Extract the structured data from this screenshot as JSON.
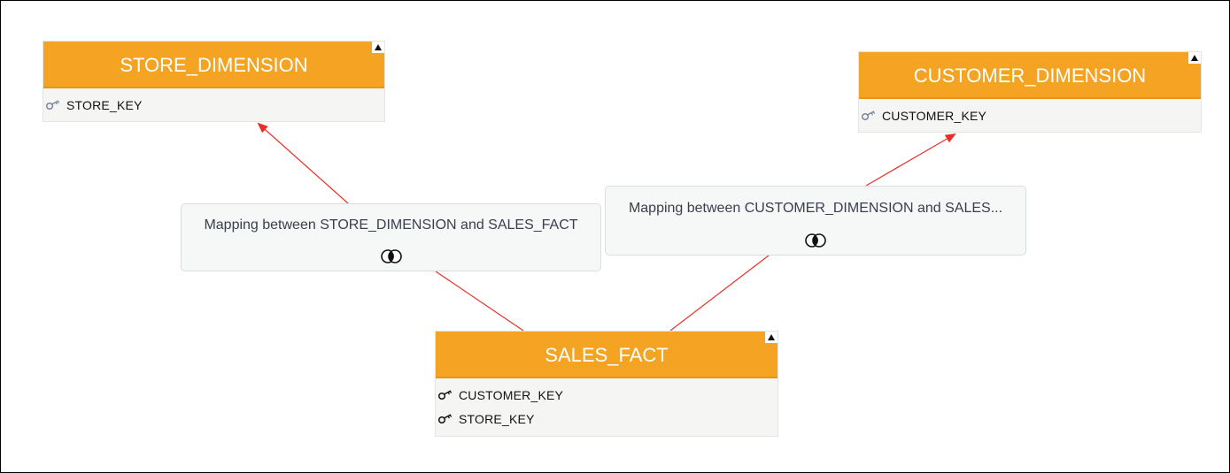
{
  "entities": {
    "store_dimension": {
      "title": "STORE_DIMENSION",
      "attributes": [
        {
          "name": "STORE_KEY",
          "icon": "key-icon"
        }
      ]
    },
    "customer_dimension": {
      "title": "CUSTOMER_DIMENSION",
      "attributes": [
        {
          "name": "CUSTOMER_KEY",
          "icon": "key-icon"
        }
      ]
    },
    "sales_fact": {
      "title": "SALES_FACT",
      "attributes": [
        {
          "name": "CUSTOMER_KEY",
          "icon": "key-icon"
        },
        {
          "name": "STORE_KEY",
          "icon": "key-icon"
        }
      ]
    }
  },
  "mappings": {
    "store_sales": {
      "label": "Mapping between STORE_DIMENSION and SALES_FACT",
      "icon": "inner-join-icon"
    },
    "customer_sales": {
      "label": "Mapping between CUSTOMER_DIMENSION and SALES...",
      "icon": "inner-join-icon"
    }
  },
  "colors": {
    "entity_header": "#f4a322",
    "connector": "#e8302a",
    "card_background": "#f6f7f7"
  }
}
